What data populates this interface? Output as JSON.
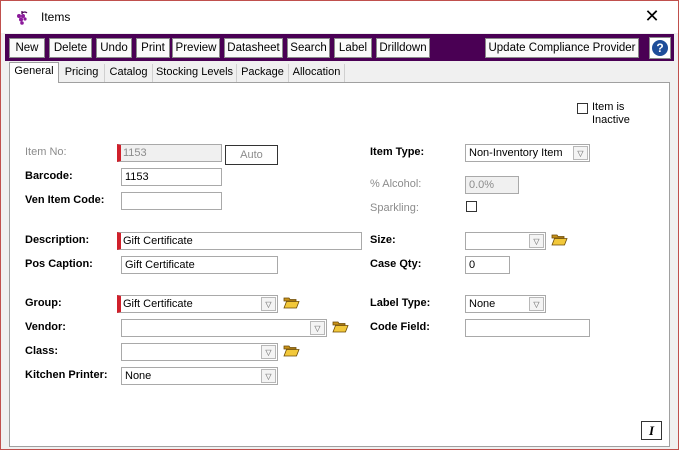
{
  "window": {
    "title": "Items",
    "close_glyph": "✕"
  },
  "toolbar": {
    "buttons": [
      "New",
      "Delete",
      "Undo",
      "Print",
      "Preview",
      "Datasheet",
      "Search",
      "Label",
      "Drilldown"
    ],
    "compliance_label": "Update Compliance Provider",
    "help_glyph": "?"
  },
  "tabs": [
    "General",
    "Pricing",
    "Catalog",
    "Stocking Levels",
    "Package",
    "Allocation"
  ],
  "active_tab": "General",
  "form": {
    "inactive_label_line1": "Item is",
    "inactive_label_line2": "Inactive",
    "item_no_label": "Item No:",
    "item_no_value": "1153",
    "auto_label": "Auto",
    "barcode_label": "Barcode:",
    "barcode_value": "1153",
    "ven_item_code_label": "Ven Item Code:",
    "ven_item_code_value": "",
    "description_label": "Description:",
    "description_value": "Gift Certificate",
    "pos_caption_label": "Pos Caption:",
    "pos_caption_value": "Gift Certificate",
    "group_label": "Group:",
    "group_value": "Gift Certificate",
    "vendor_label": "Vendor:",
    "vendor_value": "",
    "class_label": "Class:",
    "class_value": "",
    "kitchen_printer_label": "Kitchen Printer:",
    "kitchen_printer_value": "None",
    "item_type_label": "Item Type:",
    "item_type_value": "Non-Inventory Item",
    "alcohol_label": "% Alcohol:",
    "alcohol_value": "0.0%",
    "sparkling_label": "Sparkling:",
    "size_label": "Size:",
    "size_value": "",
    "case_qty_label": "Case Qty:",
    "case_qty_value": "0",
    "label_type_label": "Label Type:",
    "label_type_value": "None",
    "code_field_label": "Code Field:",
    "code_field_value": "",
    "italic_button": "I"
  },
  "colors": {
    "toolbar_bg": "#4a0054",
    "required_marker": "#d0202b",
    "folder": "#d8a51c",
    "help": "#1f4e9a"
  }
}
